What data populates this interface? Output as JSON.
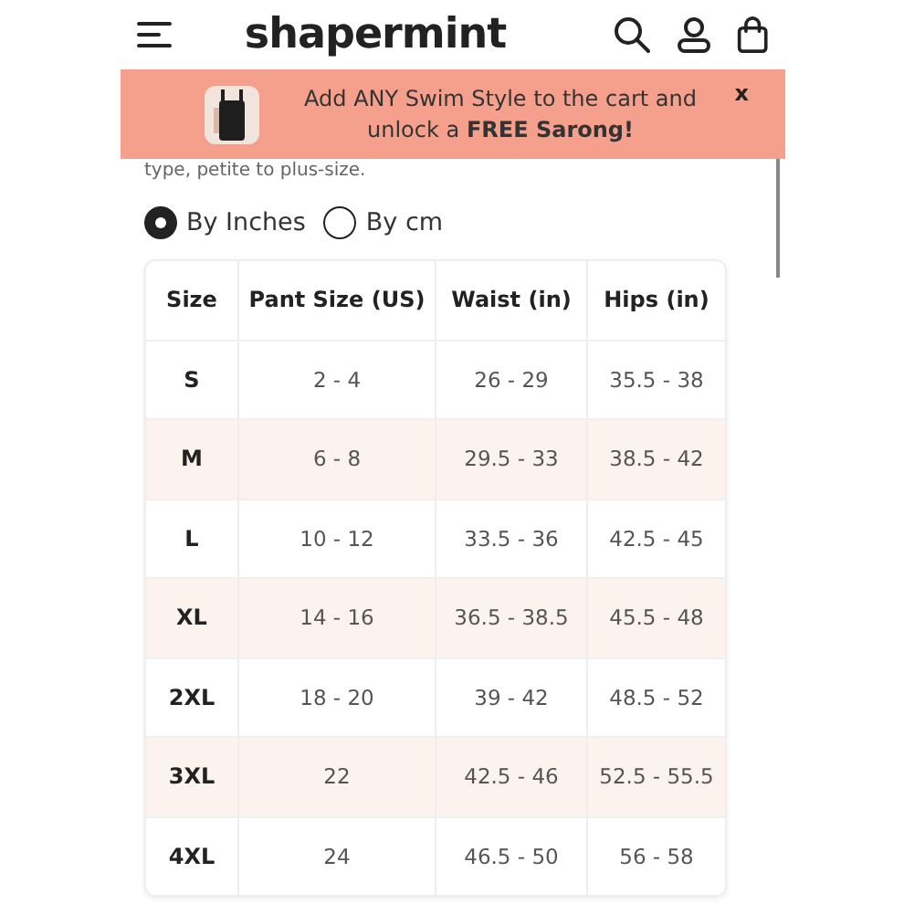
{
  "header": {
    "logo": "shapermint"
  },
  "banner": {
    "text": "Add ANY Swim Style to the cart and unlock a **FREE Sarong!**",
    "close": "x"
  },
  "intro": "type, petite to plus-size.",
  "units": [
    {
      "label": "By Inches",
      "selected": true
    },
    {
      "label": "By cm",
      "selected": false
    }
  ],
  "table": {
    "columns": [
      "Size",
      "Pant Size (US)",
      "Waist (in)",
      "Hips (in)"
    ],
    "rows": [
      [
        "S",
        "2 - 4",
        "26 - 29",
        "35.5 - 38"
      ],
      [
        "M",
        "6 - 8",
        "29.5 - 33",
        "38.5 - 42"
      ],
      [
        "L",
        "10 - 12",
        "33.5 - 36",
        "42.5 - 45"
      ],
      [
        "XL",
        "14 - 16",
        "36.5 - 38.5",
        "45.5 - 48"
      ],
      [
        "2XL",
        "18 - 20",
        "39 - 42",
        "48.5 - 52"
      ],
      [
        "3XL",
        "22",
        "42.5 - 46",
        "52.5 - 55.5"
      ],
      [
        "4XL",
        "24",
        "46.5 - 50",
        "56 - 58"
      ]
    ]
  }
}
